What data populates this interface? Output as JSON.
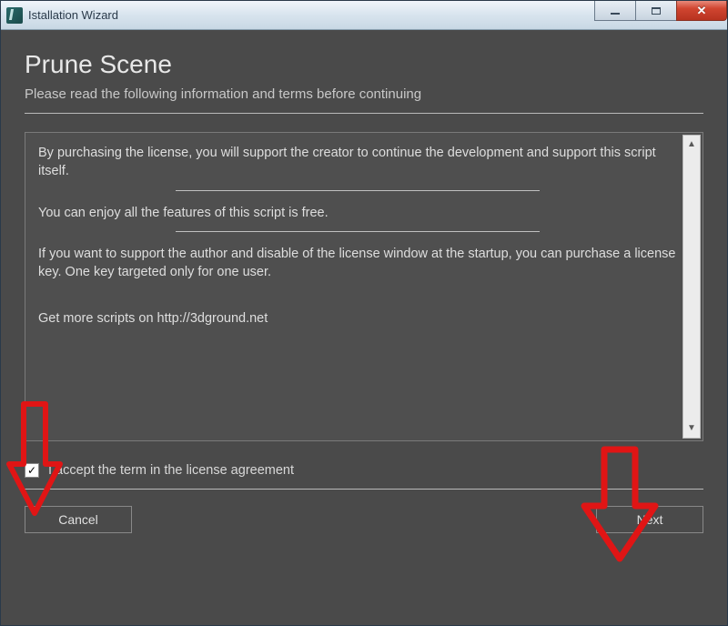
{
  "window": {
    "title": "Istallation Wizard"
  },
  "wizard": {
    "heading": "Prune Scene",
    "subheading": "Please read the following information and terms before continuing"
  },
  "license": {
    "p1": "By purchasing the license, you will support the creator  to continue the development and support this script itself.",
    "p2": "You can enjoy all the features of this script is free.",
    "p3": "If you want to support the author and disable of the license window at the startup, you can purchase a license key. One key targeted only for one user.",
    "p4": "Get more scripts on http://3dground.net"
  },
  "accept": {
    "checked": true,
    "label": "I accept the term in the license agreement"
  },
  "buttons": {
    "cancel": "Cancel",
    "next": "Next"
  }
}
